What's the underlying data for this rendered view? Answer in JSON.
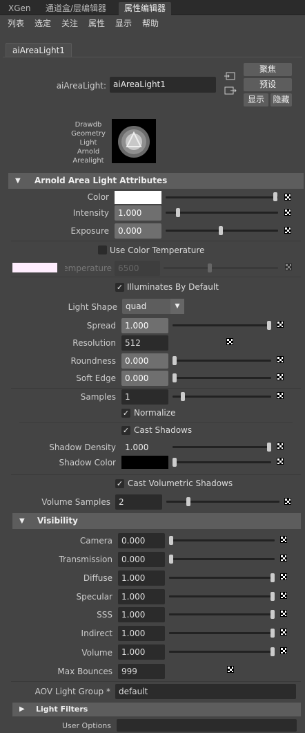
{
  "tabs": [
    "XGen",
    "通道盒/层编辑器",
    "属性编辑器"
  ],
  "menu": [
    "列表",
    "选定",
    "关注",
    "属性",
    "显示",
    "帮助"
  ],
  "node_tab": "aiAreaLight1",
  "node": {
    "type_label": "aiAreaLight:",
    "name": "aiAreaLight1"
  },
  "buttons": {
    "focus": "聚焦",
    "presets": "预设",
    "show": "显示",
    "hide": "隐藏"
  },
  "swatch_caption": [
    "Drawdb",
    "Geometry",
    "Light",
    "Arnold",
    "Arealight"
  ],
  "sections": {
    "arnold": "Arnold Area Light Attributes",
    "visibility": "Visibility",
    "light_filters": "Light Filters"
  },
  "attrs": {
    "color": {
      "label": "Color",
      "hex": "#ffffff"
    },
    "intensity": {
      "label": "Intensity",
      "value": "1.000"
    },
    "exposure": {
      "label": "Exposure",
      "value": "0.000"
    },
    "use_color_temp": {
      "label": "Use Color Temperature",
      "checked": false
    },
    "temperature": {
      "label": "Temperature",
      "value": "6500",
      "swatch": "#ffeefe"
    },
    "illuminates": {
      "label": "Illuminates By Default",
      "checked": true
    },
    "light_shape": {
      "label": "Light Shape",
      "value": "quad"
    },
    "spread": {
      "label": "Spread",
      "value": "1.000"
    },
    "resolution": {
      "label": "Resolution",
      "value": "512"
    },
    "roundness": {
      "label": "Roundness",
      "value": "0.000"
    },
    "soft_edge": {
      "label": "Soft Edge",
      "value": "0.000"
    },
    "samples": {
      "label": "Samples",
      "value": "1"
    },
    "normalize": {
      "label": "Normalize",
      "checked": true
    },
    "cast_shadows": {
      "label": "Cast Shadows",
      "checked": true
    },
    "shadow_density": {
      "label": "Shadow Density",
      "value": "1.000"
    },
    "shadow_color": {
      "label": "Shadow Color",
      "hex": "#000000"
    },
    "cast_vol": {
      "label": "Cast Volumetric Shadows",
      "checked": true
    },
    "volume_samples": {
      "label": "Volume Samples",
      "value": "2"
    }
  },
  "visibility": {
    "camera": {
      "label": "Camera",
      "value": "0.000"
    },
    "transmission": {
      "label": "Transmission",
      "value": "0.000"
    },
    "diffuse": {
      "label": "Diffuse",
      "value": "1.000"
    },
    "specular": {
      "label": "Specular",
      "value": "1.000"
    },
    "sss": {
      "label": "SSS",
      "value": "1.000"
    },
    "indirect": {
      "label": "Indirect",
      "value": "1.000"
    },
    "volume": {
      "label": "Volume",
      "value": "1.000"
    },
    "max_bounces": {
      "label": "Max Bounces",
      "value": "999"
    }
  },
  "aov": {
    "label": "AOV Light Group *",
    "value": "default"
  },
  "user_options": {
    "label": "User Options"
  }
}
